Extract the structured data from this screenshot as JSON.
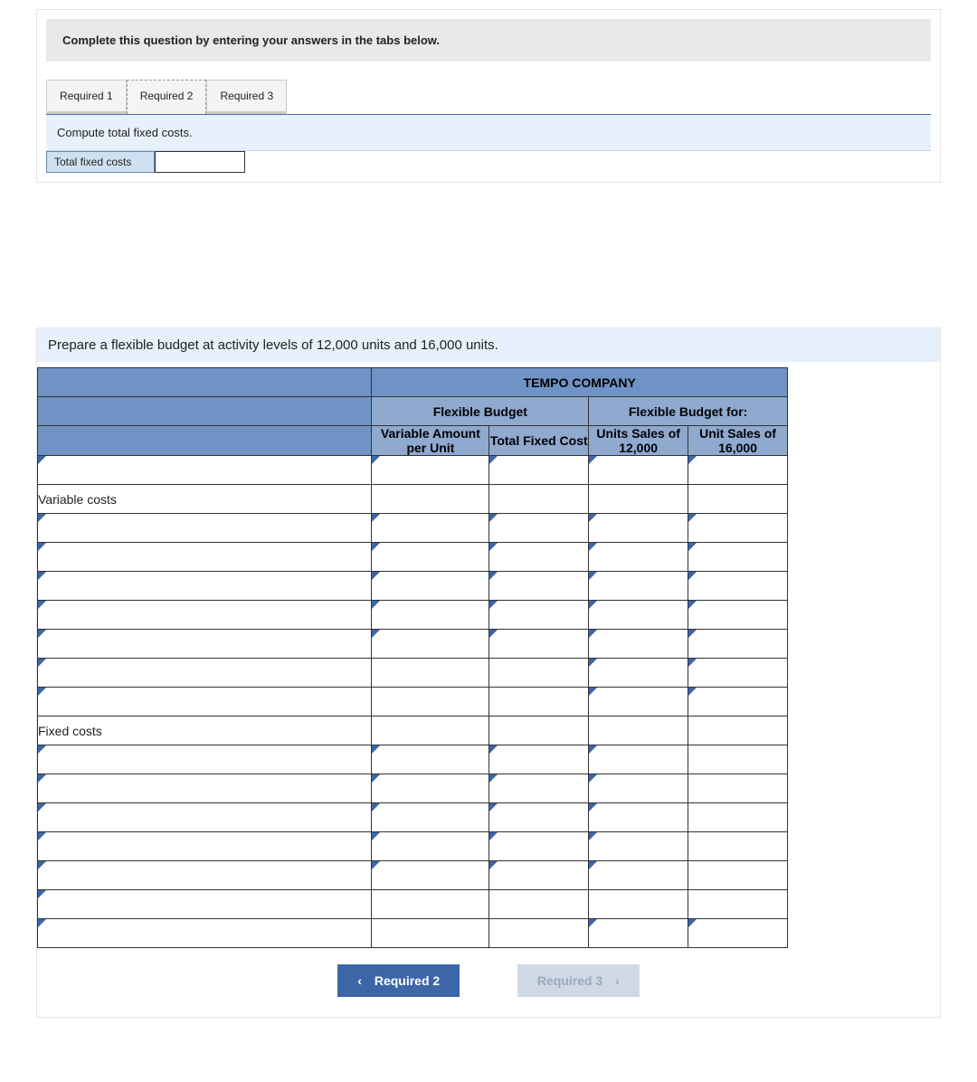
{
  "top": {
    "instruction": "Complete this question by entering your answers in the tabs below.",
    "tabs": [
      "Required 1",
      "Required 2",
      "Required 3"
    ],
    "sub_instruction": "Compute total fixed costs.",
    "field_label": "Total fixed costs",
    "field_value": ""
  },
  "flex": {
    "instruction": "Prepare a flexible budget at activity levels of 12,000 units and 16,000 units.",
    "company": "TEMPO COMPANY",
    "group1": "Flexible Budget",
    "group2": "Flexible Budget for:",
    "col_headers": {
      "c1": "Variable Amount per Unit",
      "c2": "Total Fixed Cost",
      "c3": "Units Sales of 12,000",
      "c4": "Unit Sales of 16,000"
    },
    "sections": {
      "variable": "Variable costs",
      "fixed": "Fixed costs"
    },
    "nav": {
      "prev": "Required 2",
      "next": "Required 3"
    }
  },
  "chart_data": {
    "type": "table",
    "title": "TEMPO COMPANY — Flexible Budget",
    "column_groups": [
      {
        "label": "Flexible Budget",
        "columns": [
          "Variable Amount per Unit",
          "Total Fixed Cost"
        ]
      },
      {
        "label": "Flexible Budget for:",
        "columns": [
          "Units Sales of 12,000",
          "Unit Sales of 16,000"
        ]
      }
    ],
    "sections": [
      {
        "label": "Variable costs",
        "input_rows": 7,
        "values": []
      },
      {
        "label": "Fixed costs",
        "input_rows": 7,
        "values": []
      }
    ],
    "note": "All data cells are blank user-entry fields in the screenshot."
  }
}
